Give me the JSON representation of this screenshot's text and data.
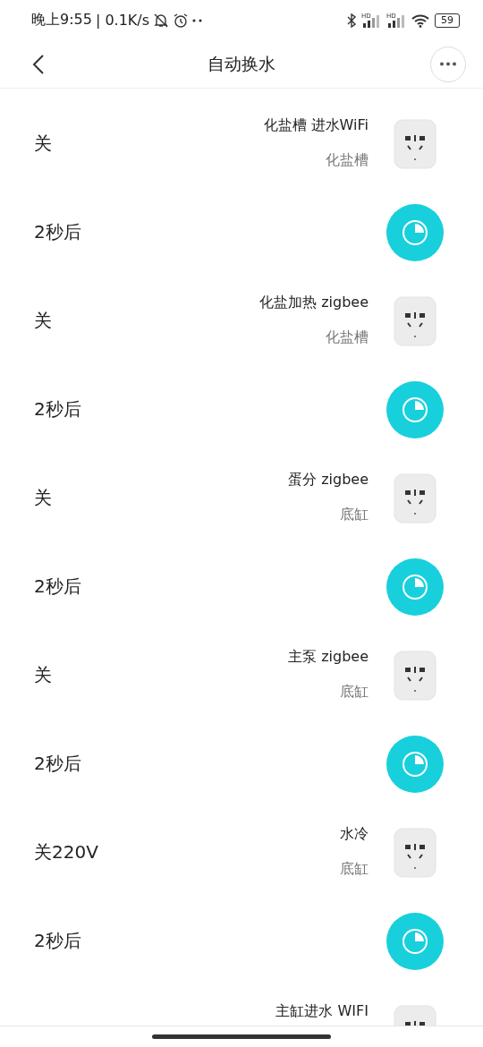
{
  "status_bar": {
    "time": "晚上9:55",
    "speed": "| 0.1K/s",
    "signals": [
      {
        "label": "HD"
      },
      {
        "label": "HD"
      }
    ],
    "battery": "59"
  },
  "header": {
    "title": "自动换水"
  },
  "rows": [
    {
      "kind": "device",
      "action": "关",
      "name": "化盐槽 进水WiFi",
      "room": "化盐槽"
    },
    {
      "kind": "delay",
      "action": "2秒后"
    },
    {
      "kind": "device",
      "action": "关",
      "name": "化盐加热 zigbee",
      "room": "化盐槽"
    },
    {
      "kind": "delay",
      "action": "2秒后"
    },
    {
      "kind": "device",
      "action": "关",
      "name": "蛋分 zigbee",
      "room": "底缸"
    },
    {
      "kind": "delay",
      "action": "2秒后"
    },
    {
      "kind": "device",
      "action": "关",
      "name": "主泵 zigbee",
      "room": "底缸"
    },
    {
      "kind": "delay",
      "action": "2秒后"
    },
    {
      "kind": "device",
      "action": "关220V",
      "name": "水冷",
      "room": "底缸"
    },
    {
      "kind": "delay",
      "action": "2秒后"
    },
    {
      "kind": "device",
      "name": "主缸进水 WIFI"
    }
  ]
}
